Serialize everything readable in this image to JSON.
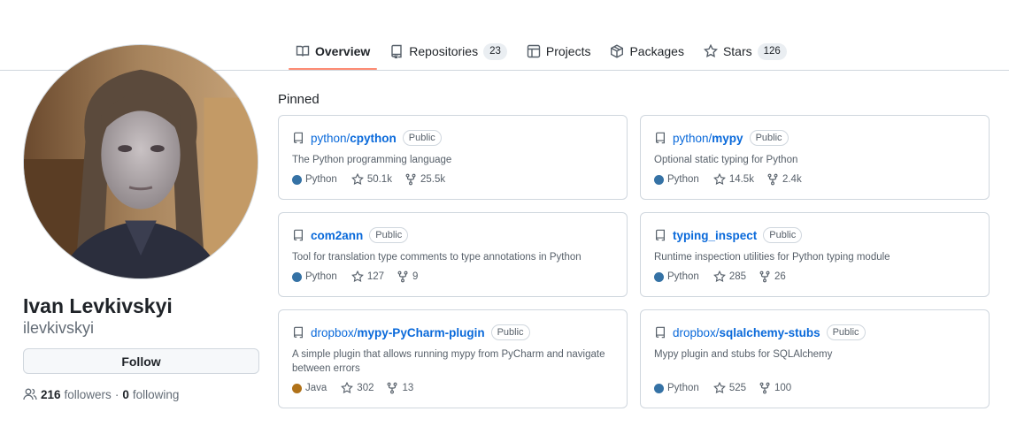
{
  "nav": {
    "tabs": [
      {
        "label": "Overview",
        "icon": "book-icon",
        "active": true
      },
      {
        "label": "Repositories",
        "icon": "repo-icon",
        "count": "23"
      },
      {
        "label": "Projects",
        "icon": "table-icon"
      },
      {
        "label": "Packages",
        "icon": "package-icon"
      },
      {
        "label": "Stars",
        "icon": "star-icon",
        "count": "126"
      }
    ]
  },
  "profile": {
    "full_name": "Ivan Levkivskyi",
    "username": "ilevkivskyi",
    "follow_label": "Follow",
    "followers_count": "216",
    "followers_label": "followers",
    "separator": "·",
    "following_count": "0",
    "following_label": "following"
  },
  "pinned": {
    "title": "Pinned",
    "repos": [
      {
        "owner": "python/",
        "name": "cpython",
        "visibility": "Public",
        "description": "The Python programming language",
        "language": "Python",
        "language_color": "#3572A5",
        "stars": "50.1k",
        "forks": "25.5k"
      },
      {
        "owner": "python/",
        "name": "mypy",
        "visibility": "Public",
        "description": "Optional static typing for Python",
        "language": "Python",
        "language_color": "#3572A5",
        "stars": "14.5k",
        "forks": "2.4k"
      },
      {
        "owner": "",
        "name": "com2ann",
        "visibility": "Public",
        "description": "Tool for translation type comments to type annotations in Python",
        "language": "Python",
        "language_color": "#3572A5",
        "stars": "127",
        "forks": "9"
      },
      {
        "owner": "",
        "name": "typing_inspect",
        "visibility": "Public",
        "description": "Runtime inspection utilities for Python typing module",
        "language": "Python",
        "language_color": "#3572A5",
        "stars": "285",
        "forks": "26"
      },
      {
        "owner": "dropbox/",
        "name": "mypy-PyCharm-plugin",
        "visibility": "Public",
        "description": "A simple plugin that allows running mypy from PyCharm and navigate between errors",
        "language": "Java",
        "language_color": "#b07219",
        "stars": "302",
        "forks": "13"
      },
      {
        "owner": "dropbox/",
        "name": "sqlalchemy-stubs",
        "visibility": "Public",
        "description": "Mypy plugin and stubs for SQLAlchemy",
        "language": "Python",
        "language_color": "#3572A5",
        "stars": "525",
        "forks": "100"
      }
    ]
  }
}
